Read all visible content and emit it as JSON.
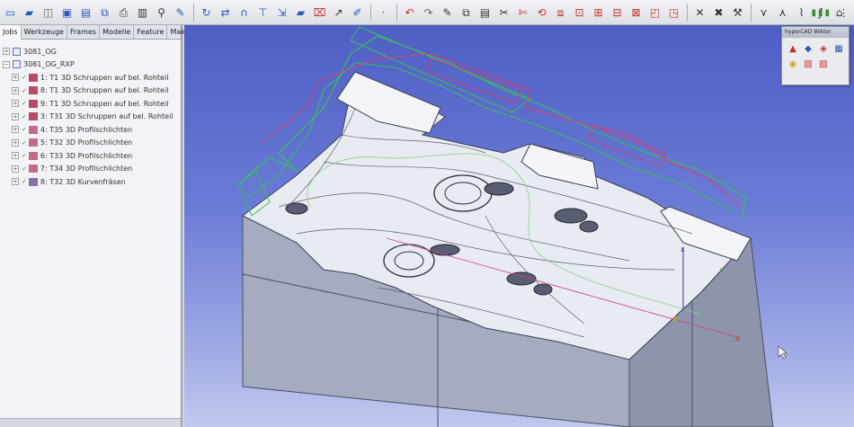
{
  "left_panel": {
    "tabs": [
      "Jobs",
      "Werkzeuge",
      "Frames",
      "Modelle",
      "Feature",
      "Makros"
    ],
    "tree": [
      {
        "label": "3081_OG",
        "level": 1,
        "icon": "doc"
      },
      {
        "label": "3081_OG_RXP",
        "level": 1,
        "icon": "doc"
      },
      {
        "label": "1: T1 3D Schruppen auf bel. Rohteil",
        "level": 2,
        "icon": "op"
      },
      {
        "label": "8: T1 3D Schruppen auf bel. Rohteil",
        "level": 2,
        "icon": "op"
      },
      {
        "label": "9: T1 3D Schruppen auf bel. Rohteil",
        "level": 2,
        "icon": "op"
      },
      {
        "label": "3: T31 3D Schruppen auf bel. Rohteil",
        "level": 2,
        "icon": "op"
      },
      {
        "label": "4: T35 3D Profilschlichten",
        "level": 2,
        "icon": "op2"
      },
      {
        "label": "5: T32 3D Profilschlichten",
        "level": 2,
        "icon": "op2"
      },
      {
        "label": "6: T33 3D Profilschlichten",
        "level": 2,
        "icon": "op2"
      },
      {
        "label": "7: T34 3D Profilschlichten",
        "level": 2,
        "icon": "op2"
      },
      {
        "label": "8: T32 3D Kurvenfräsen",
        "level": 2,
        "icon": "mill"
      }
    ]
  },
  "float_window": {
    "title": "hyperCAD Wiktor",
    "icons": [
      "view-icon",
      "shade-icon",
      "wire-icon",
      "layer-icon",
      "cube-icon",
      "clip-icon",
      "hide-icon"
    ]
  },
  "colors": {
    "viewport_top": "#4f5ec4",
    "viewport_bottom": "#c2c9ef",
    "part_top": "#eceef4",
    "part_side": "#a9afc0",
    "toolpath_green": "#37c05a",
    "toolpath_magenta": "#d0407a"
  }
}
